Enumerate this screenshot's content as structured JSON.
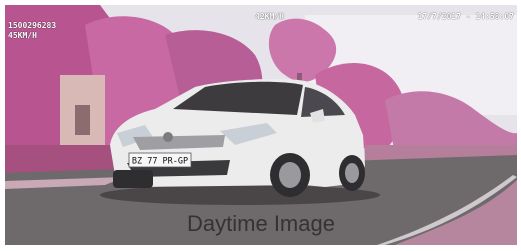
{
  "overlay": {
    "record_id": "1500296283",
    "speed_left": "45KM/H",
    "speed_top": "42KM/H",
    "datetime": "17/7/2017 - 14:58:07"
  },
  "car": {
    "plate": "BZ 77 PR-GP",
    "color": "#eeeeee"
  },
  "caption": "Daytime Image",
  "colors": {
    "sky": "#e8e8ee",
    "foliage": "#c05e98",
    "road": "#6e6a6c",
    "verge": "#b57f9c"
  }
}
